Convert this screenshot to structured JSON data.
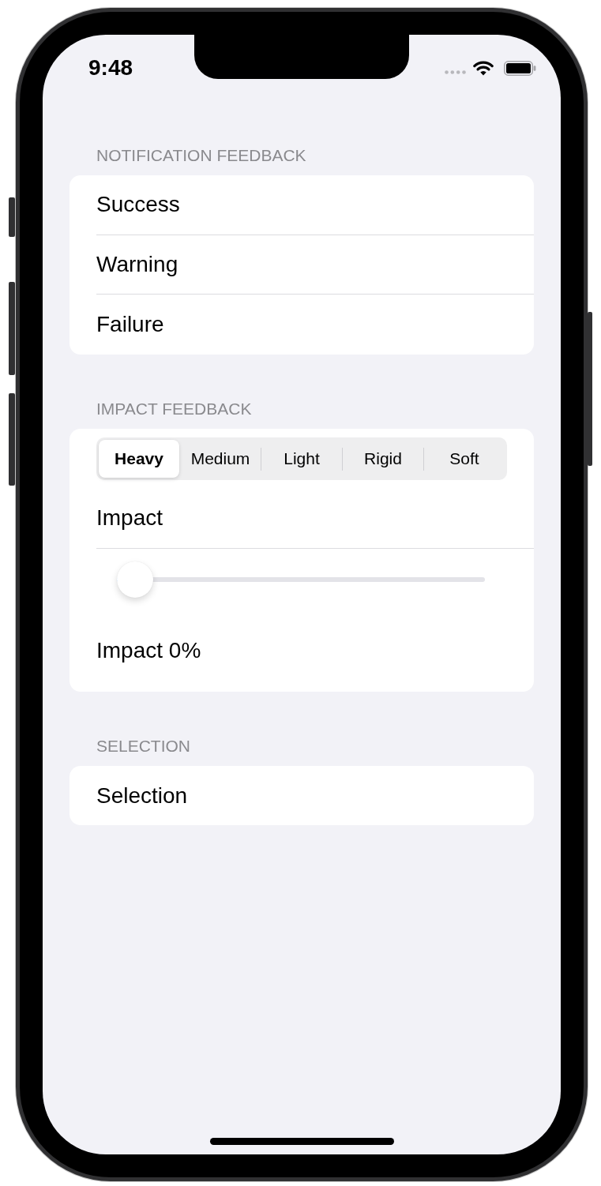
{
  "status_bar": {
    "time": "9:48"
  },
  "sections": [
    {
      "header": "NOTIFICATION FEEDBACK",
      "rows": [
        {
          "kind": "button",
          "label": "Success",
          "divider": true
        },
        {
          "kind": "button",
          "label": "Warning",
          "divider": true
        },
        {
          "kind": "button",
          "label": "Failure",
          "divider": false
        }
      ]
    },
    {
      "header": "IMPACT FEEDBACK",
      "rows": [
        {
          "kind": "segmented",
          "divider": false,
          "segments": [
            {
              "label": "Heavy",
              "selected": true
            },
            {
              "label": "Medium",
              "selected": false
            },
            {
              "label": "Light",
              "selected": false
            },
            {
              "label": "Rigid",
              "selected": false
            },
            {
              "label": "Soft",
              "selected": false
            }
          ]
        },
        {
          "kind": "button",
          "label": "Impact",
          "divider": true
        },
        {
          "kind": "slider",
          "level": 0,
          "divider": false
        },
        {
          "kind": "text",
          "label": "Impact 0%",
          "divider": false
        }
      ]
    },
    {
      "header": "SELECTION",
      "rows": [
        {
          "kind": "button",
          "label": "Selection",
          "divider": false
        }
      ]
    }
  ]
}
